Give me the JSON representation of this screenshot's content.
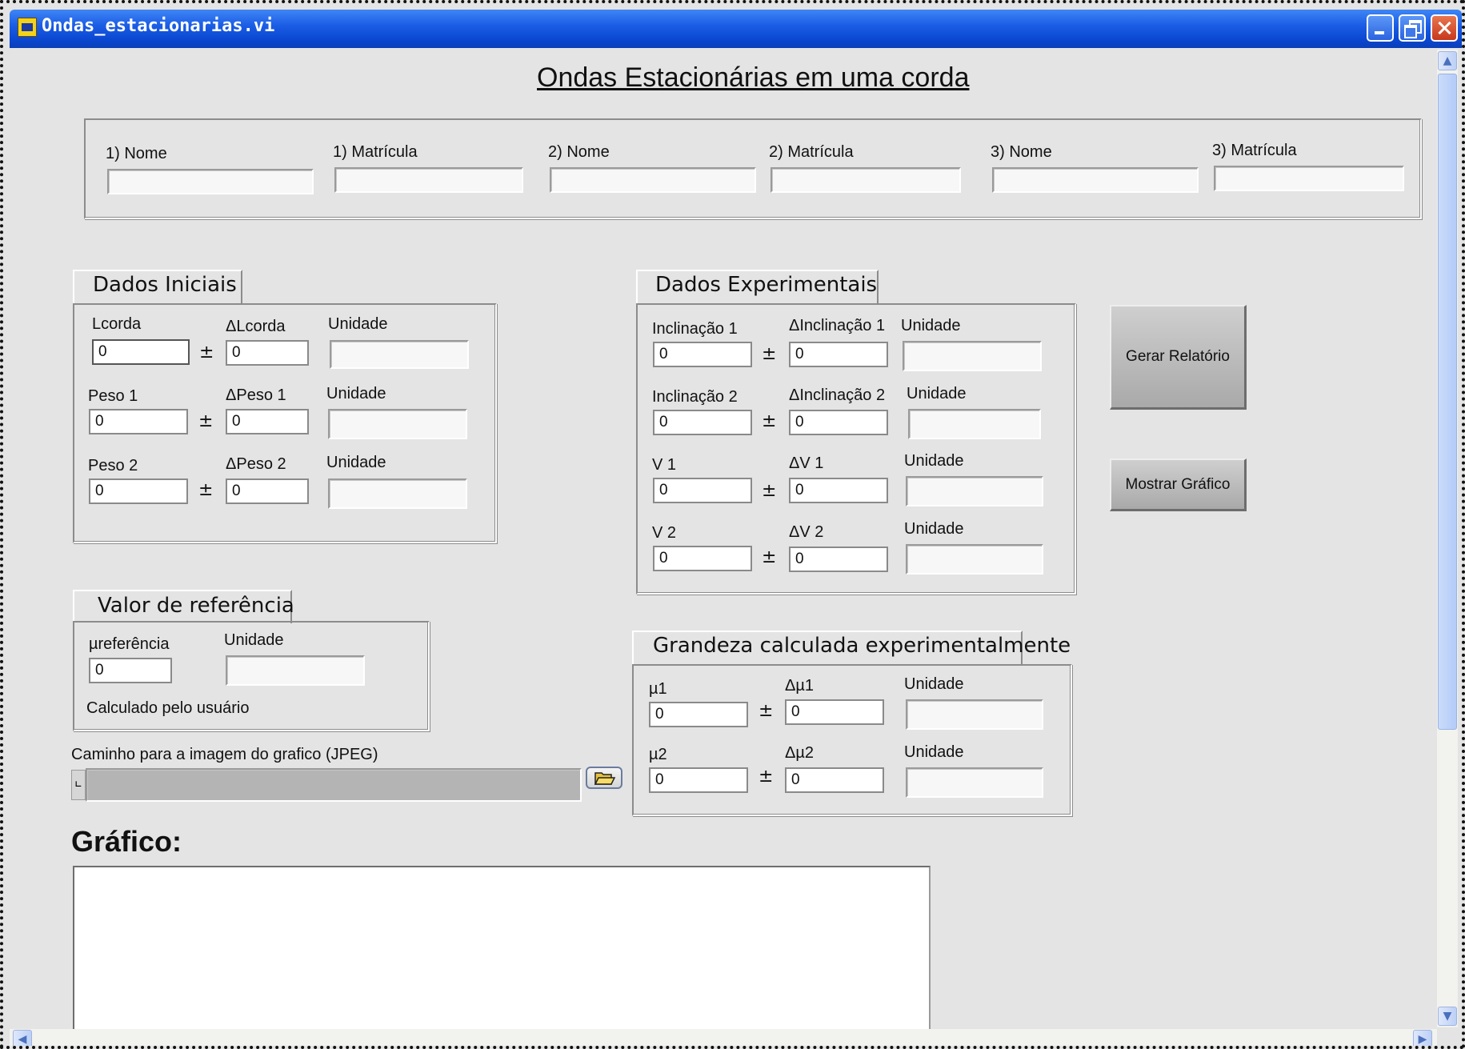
{
  "window": {
    "title": "Ondas_estacionarias.vi"
  },
  "page_title": "Ondas Estacionárias em uma corda",
  "students": {
    "labels": [
      "1) Nome",
      "1) Matrícula",
      "2) Nome",
      "2) Matrícula",
      "3) Nome",
      "3) Matrícula"
    ]
  },
  "dados_iniciais": {
    "title": "Dados Iniciais",
    "lcorda_label": "Lcorda",
    "lcorda_value": "0",
    "dlcorda_label": "ΔLcorda",
    "dlcorda_value": "0",
    "unidade1_label": "Unidade",
    "peso1_label": "Peso 1",
    "peso1_value": "0",
    "dpeso1_label": "ΔPeso 1",
    "dpeso1_value": "0",
    "unidade2_label": "Unidade",
    "peso2_label": "Peso 2",
    "peso2_value": "0",
    "dpeso2_label": "ΔPeso 2",
    "dpeso2_value": "0",
    "unidade3_label": "Unidade"
  },
  "dados_experimentais": {
    "title": "Dados Experimentais",
    "incl1_label": "Inclinação 1",
    "incl1_value": "0",
    "dincl1_label": "ΔInclinação 1",
    "dincl1_value": "0",
    "unidade1_label": "Unidade",
    "incl2_label": "Inclinação 2",
    "incl2_value": "0",
    "dincl2_label": "ΔInclinação 2",
    "dincl2_value": "0",
    "unidade2_label": "Unidade",
    "v1_label": "V 1",
    "v1_value": "0",
    "dv1_label": "ΔV 1",
    "dv1_value": "0",
    "unidade3_label": "Unidade",
    "v2_label": "V 2",
    "v2_value": "0",
    "dv2_label": "ΔV 2",
    "dv2_value": "0",
    "unidade4_label": "Unidade"
  },
  "valor_referencia": {
    "title": "Valor de referência",
    "mu_label": "µreferência",
    "mu_value": "0",
    "unidade_label": "Unidade",
    "note": "Calculado pelo usuário"
  },
  "grandeza": {
    "title": "Grandeza calculada experimentalmente",
    "mu1_label": "µ1",
    "mu1_value": "0",
    "dmu1_label": "Δµ1",
    "dmu1_value": "0",
    "unidade1_label": "Unidade",
    "mu2_label": "µ2",
    "mu2_value": "0",
    "dmu2_label": "Δµ2",
    "dmu2_value": "0",
    "unidade2_label": "Unidade"
  },
  "path": {
    "label": "Caminho para a imagem do grafico (JPEG)",
    "value": ""
  },
  "buttons": {
    "gerar": "Gerar Relatório",
    "mostrar": "Mostrar Gráfico"
  },
  "grafico": {
    "title": "Gráfico:"
  },
  "pm_symbol": "±",
  "icons": [
    "vi-app-icon",
    "minimize-icon",
    "restore-icon",
    "close-icon",
    "folder-open-icon",
    "path-icon",
    "scroll-up-icon",
    "scroll-down-icon",
    "scroll-left-icon",
    "scroll-right-icon"
  ]
}
